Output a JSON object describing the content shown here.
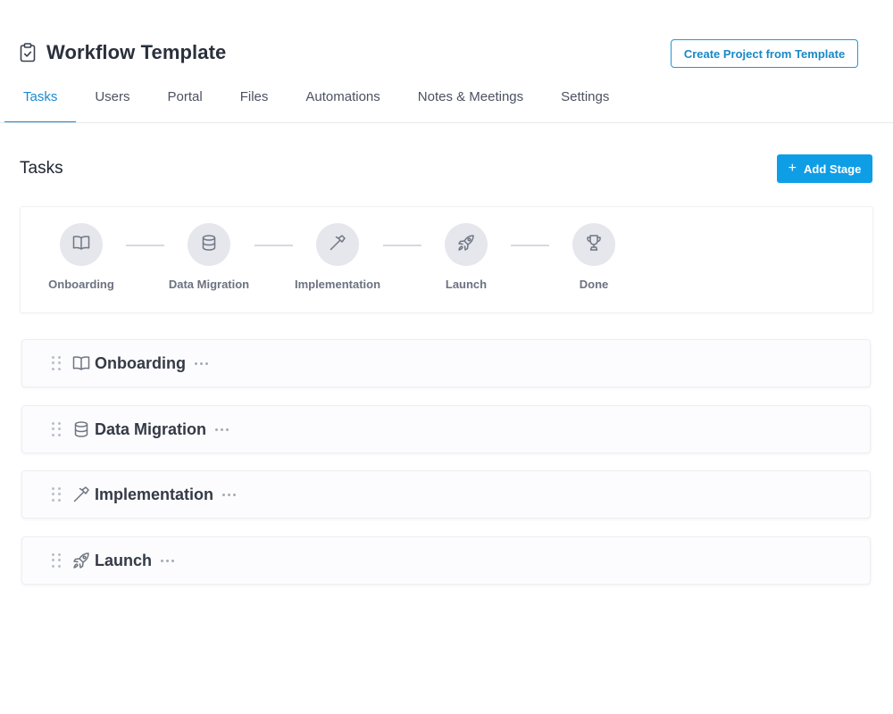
{
  "header": {
    "title": "Workflow Template",
    "title_icon": "clipboard-check-icon",
    "create_button_label": "Create Project from Template"
  },
  "tabs": [
    {
      "label": "Tasks",
      "active": true
    },
    {
      "label": "Users",
      "active": false
    },
    {
      "label": "Portal",
      "active": false
    },
    {
      "label": "Files",
      "active": false
    },
    {
      "label": "Automations",
      "active": false
    },
    {
      "label": "Notes & Meetings",
      "active": false
    },
    {
      "label": "Settings",
      "active": false
    }
  ],
  "tasks_section": {
    "title": "Tasks",
    "add_stage_label": "Add Stage",
    "add_stage_icon": "plus-icon"
  },
  "stage_flow": [
    {
      "label": "Onboarding",
      "icon": "book-icon"
    },
    {
      "label": "Data Migration",
      "icon": "database-icon"
    },
    {
      "label": "Implementation",
      "icon": "hammer-icon"
    },
    {
      "label": "Launch",
      "icon": "rocket-icon"
    },
    {
      "label": "Done",
      "icon": "trophy-icon"
    }
  ],
  "stages": [
    {
      "title": "Onboarding",
      "icon": "book-icon"
    },
    {
      "title": "Data Migration",
      "icon": "database-icon"
    },
    {
      "title": "Implementation",
      "icon": "hammer-icon"
    },
    {
      "title": "Launch",
      "icon": "rocket-icon"
    }
  ],
  "colors": {
    "accent": "#1a8ad0",
    "primary_button": "#0e9ee6",
    "stage_circle": "#e5e7ed"
  }
}
